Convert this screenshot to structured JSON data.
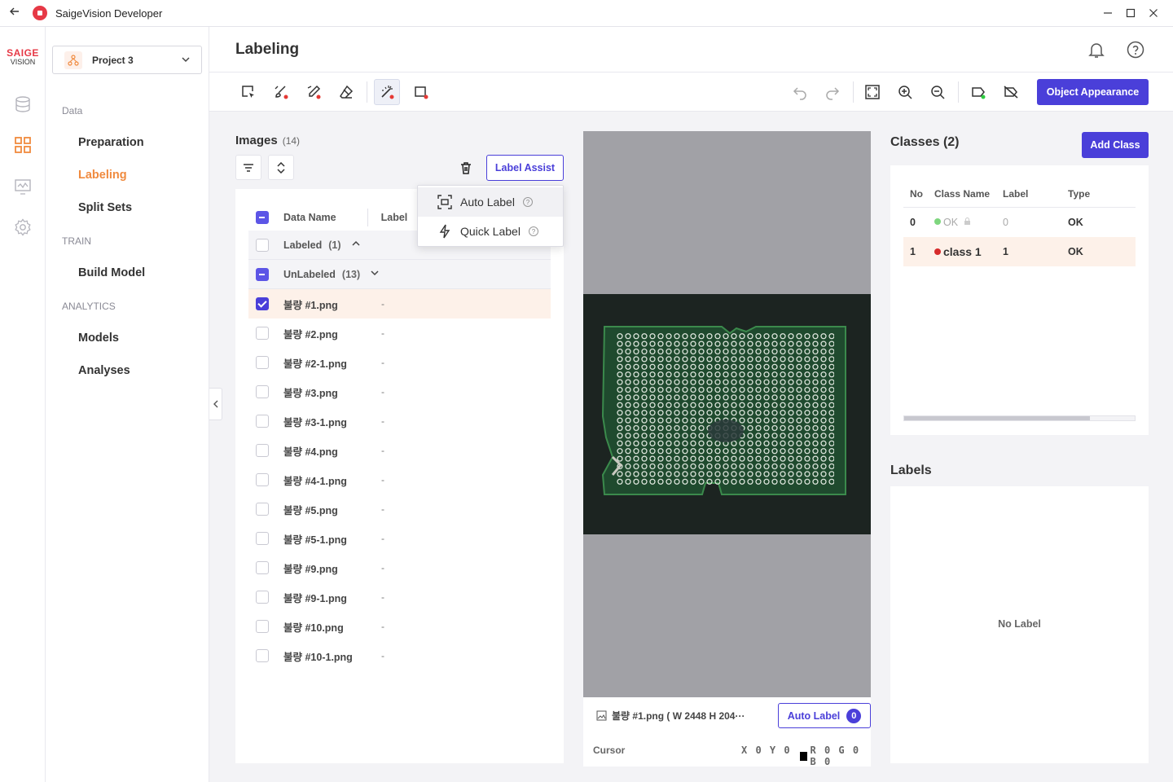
{
  "window": {
    "title": "SaigeVision Developer",
    "back_icon": "arrow-left-icon",
    "controls": [
      "minimize-icon",
      "maximize-icon",
      "close-icon"
    ]
  },
  "brand": {
    "top": "SAIGE",
    "bottom": "VISION",
    "color": "#e63946"
  },
  "project": {
    "name": "Project 3"
  },
  "nav": {
    "sections": [
      {
        "title": "Data",
        "items": [
          "Preparation",
          "Labeling",
          "Split Sets"
        ]
      },
      {
        "title": "TRAIN",
        "items": [
          "Build Model"
        ]
      },
      {
        "title": "ANALYTICS",
        "items": [
          "Models",
          "Analyses"
        ]
      }
    ],
    "active": "Labeling",
    "accent": "#f08a3e"
  },
  "header": {
    "title": "Labeling"
  },
  "toolbar": {
    "left_tools": [
      "select-box-tool-icon",
      "brush-tool-icon",
      "pen-tool-icon",
      "eraser-icon",
      "magic-wand-icon",
      "roi-box-icon"
    ],
    "right_tools": [
      "undo-icon",
      "redo-icon",
      "fit-screen-icon",
      "zoom-in-icon",
      "zoom-out-icon",
      "show-labels-icon",
      "hide-labels-icon"
    ],
    "object_appearance": "Object Appearance"
  },
  "images": {
    "title": "Images",
    "count": "(14)",
    "label_assist": "Label Assist",
    "columns": {
      "name": "Data Name",
      "label": "Label"
    },
    "groups": {
      "labeled": {
        "name": "Labeled",
        "count": "(1)"
      },
      "unlabeled": {
        "name": "UnLabeled",
        "count": "(13)"
      }
    },
    "files": [
      {
        "name": "불량 #1.png",
        "label": "-"
      },
      {
        "name": "불량 #2.png",
        "label": "-"
      },
      {
        "name": "불량 #2-1.png",
        "label": "-"
      },
      {
        "name": "불량 #3.png",
        "label": "-"
      },
      {
        "name": "불량 #3-1.png",
        "label": "-"
      },
      {
        "name": "불량 #4.png",
        "label": "-"
      },
      {
        "name": "불량 #4-1.png",
        "label": "-"
      },
      {
        "name": "불량 #5.png",
        "label": "-"
      },
      {
        "name": "불량 #5-1.png",
        "label": "-"
      },
      {
        "name": "불량 #9.png",
        "label": "-"
      },
      {
        "name": "불량 #9-1.png",
        "label": "-"
      },
      {
        "name": "불량 #10.png",
        "label": "-"
      },
      {
        "name": "불량 #10-1.png",
        "label": "-"
      }
    ]
  },
  "label_assist_menu": {
    "items": [
      {
        "label": "Auto Label",
        "icon": "auto-label-icon"
      },
      {
        "label": "Quick Label",
        "icon": "lightning-icon"
      }
    ]
  },
  "viewer": {
    "file_info": "불량 #1.png ( W 2448 H 204···",
    "auto_label": "Auto Label",
    "auto_label_count": "0",
    "cursor_label": "Cursor",
    "cursor_xy": "X 0 Y 0",
    "cursor_rgb": "R 0 G 0 B 0"
  },
  "classes": {
    "title": "Classes (2)",
    "add_button": "Add Class",
    "columns": [
      "No",
      "Class Name",
      "Label",
      "Type"
    ],
    "rows": [
      {
        "no": "0",
        "name": "OK",
        "label": "0",
        "type": "OK",
        "color": "#7ed67e"
      },
      {
        "no": "1",
        "name": "class 1",
        "label": "1",
        "type": "OK",
        "color": "#d62b2b"
      }
    ]
  },
  "labels": {
    "title": "Labels",
    "empty": "No Label"
  }
}
